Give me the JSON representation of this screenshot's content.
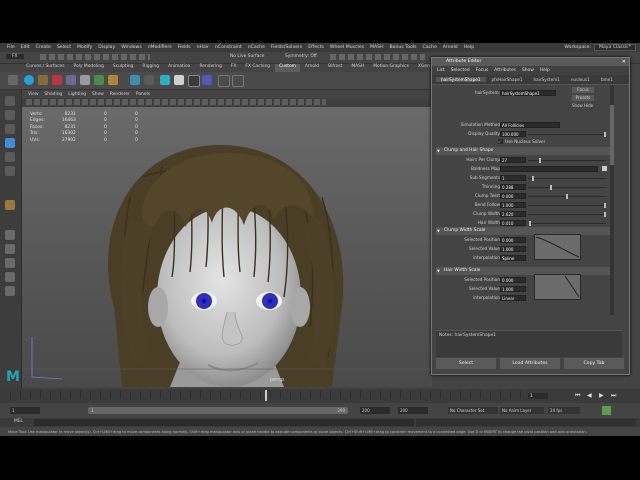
{
  "app": {
    "logo": "M"
  },
  "menubar": {
    "items": [
      "File",
      "Edit",
      "Create",
      "Select",
      "Modify",
      "Display",
      "Windows",
      "nModifiers",
      "Fields",
      "nHair",
      "nConstraint",
      "nCache",
      "Fields/Solvers",
      "Effects",
      "Wheel Muscles",
      "MASH",
      "Bonus Tools",
      "Cache",
      "Arnold",
      "Help"
    ],
    "workspace_label": "Workspace:",
    "workspace_value": "Maya Classic*"
  },
  "statusline": {
    "mode": "FX",
    "live_surface": "No Live Surface",
    "symmetry": "Symmetry: Off"
  },
  "shelf": {
    "tabs": [
      "Curves / Surfaces",
      "Poly Modeling",
      "Sculpting",
      "Rigging",
      "Animation",
      "Rendering",
      "FX",
      "FX Caching",
      "Custom",
      "Arnold",
      "Bifrost",
      "MASH",
      "Motion Graphics",
      "XGen"
    ],
    "active_tab": "Custom"
  },
  "panel": {
    "menus": [
      "View",
      "Shading",
      "Lighting",
      "Show",
      "Renderer",
      "Panels"
    ]
  },
  "hud": {
    "rows": [
      {
        "label": "Verts:",
        "v1": "8231",
        "v2": "0",
        "v3": "0"
      },
      {
        "label": "Edges:",
        "v1": "16463",
        "v2": "0",
        "v3": "0"
      },
      {
        "label": "Faces:",
        "v1": "8231",
        "v2": "0",
        "v3": "0"
      },
      {
        "label": "Tris:",
        "v1": "16302",
        "v2": "0",
        "v3": "0"
      },
      {
        "label": "UVs:",
        "v1": "27992",
        "v2": "0",
        "v3": "0"
      }
    ]
  },
  "viewport": {
    "camera_label": "persp"
  },
  "attribute_editor": {
    "title": "Attribute Editor",
    "menus": [
      "List",
      "Selected",
      "Focus",
      "Attributes",
      "Show",
      "Help"
    ],
    "tabs": [
      "hairSystemShape1",
      "pfxHairShape1",
      "hairSystem1",
      "nucleus1",
      "time1"
    ],
    "active_tab": "hairSystemShape1",
    "node_label": "hairSystem:",
    "node_value": "hairSystemShape1",
    "focus_btn": "Focus",
    "presets_btn": "Presets",
    "show_btn": "Show",
    "hide_btn": "Hide",
    "simulation_method_label": "Simulation Method",
    "simulation_method_value": "All Follicles",
    "display_quality_label": "Display Quality",
    "display_quality_value": "100.000",
    "use_nucleus_label": "Use Nucleus Solver",
    "clump_section": "Clump and Hair Shape",
    "clump_rows": [
      {
        "label": "Hairs Per Clump",
        "value": "27",
        "fill": 0.15
      },
      {
        "label": "Baldness Map",
        "value": "",
        "fill": null
      },
      {
        "label": "Sub Segments",
        "value": "1",
        "fill": 0.05
      },
      {
        "label": "Thinning",
        "value": "0.288",
        "fill": 0.29
      },
      {
        "label": "Clump Twist",
        "value": "0.000",
        "fill": 0.5
      },
      {
        "label": "Bend Follow",
        "value": "1.000",
        "fill": 1.0
      },
      {
        "label": "Clump Width",
        "value": "2.620",
        "fill": 1.0
      },
      {
        "label": "Hair Width",
        "value": "0.010",
        "fill": 0.01
      }
    ],
    "clump_width_scale_section": "Clump Width Scale",
    "hair_width_scale_section": "Hair Width Scale",
    "ramp_labels": {
      "pos": "Selected Position",
      "val": "Selected Value",
      "interp": "Interpolation"
    },
    "clump_ramp": {
      "pos": "0.000",
      "val": "1.000",
      "interp": "Spline"
    },
    "hair_ramp": {
      "pos": "0.000",
      "val": "1.000",
      "interp": "Linear"
    },
    "notes_label": "Notes: hairSystemShape1",
    "buttons": {
      "select": "Select",
      "load": "Load Attributes",
      "copy": "Copy Tab"
    }
  },
  "timeline": {
    "end_frame": "200",
    "current": "1"
  },
  "rangebar": {
    "start": "1",
    "start2": "1",
    "end": "200",
    "end2": "200",
    "end3": "200",
    "character_set": "No Character Set",
    "anim_layer": "No Anim Layer",
    "fps": "24 fps"
  },
  "cmdline": {
    "lang": "MEL"
  },
  "help_text": "Move Tool: Use manipulator to move object(s). Ctrl+LMB+drag to move components along normals. Shift+drag manipulator axis or plane handle to extrude components or clone objects. Ctrl+Shift+LMB+drag to constrain movement to a connected edge. Use D or INSERT to change the pivot position and axis orientation."
}
